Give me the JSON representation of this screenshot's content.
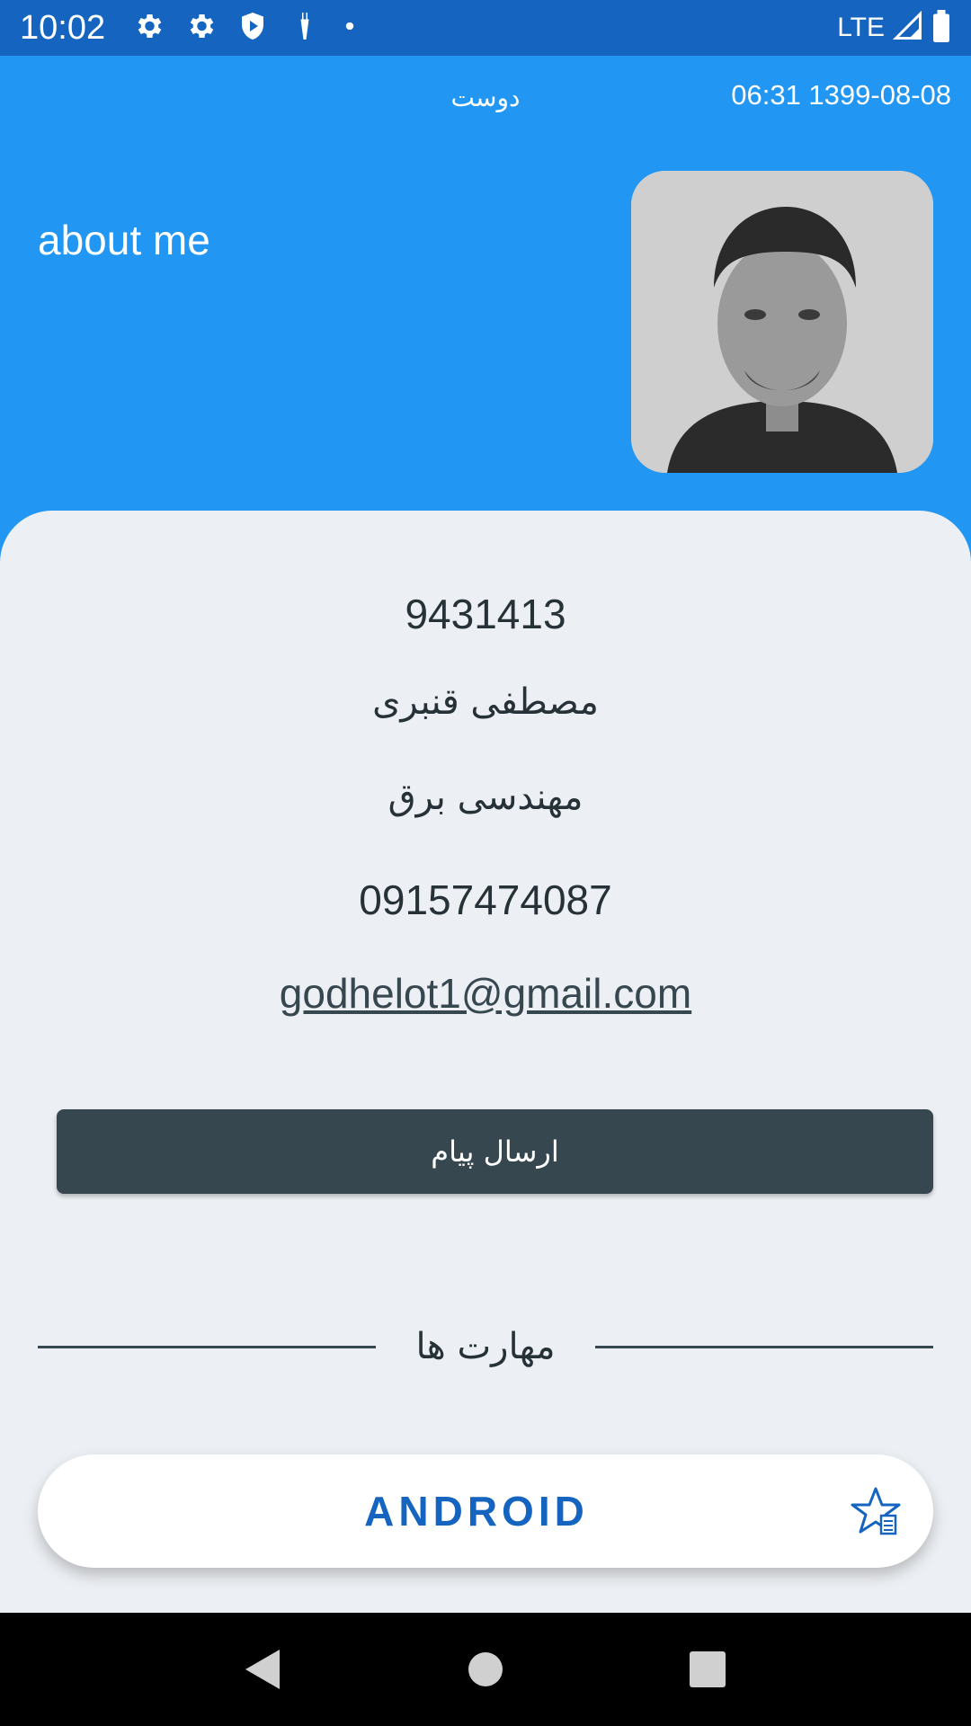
{
  "status_bar": {
    "time": "10:02",
    "icons": [
      "gear-icon",
      "gear-icon",
      "shield-play-icon",
      "carrot-icon",
      "dot-icon"
    ],
    "network": "LTE"
  },
  "header": {
    "subtitle": "دوست",
    "datetime": "06:31 1399-08-08",
    "about": "about me",
    "background_color": "#2196F3"
  },
  "profile": {
    "id": "9431413",
    "name": "مصطفی قنبری",
    "major": "مهندسی برق",
    "phone": "09157474087",
    "email": "godhelot1@gmail.com"
  },
  "actions": {
    "send_message": "ارسال پیام"
  },
  "skills": {
    "title": "مهارت ها",
    "items": [
      {
        "label": "ANDROID",
        "icon": "star-list-icon"
      }
    ]
  },
  "nav": {
    "buttons": [
      "back-icon",
      "home-icon",
      "recents-icon"
    ]
  },
  "colors": {
    "status_bar": "#1565C0",
    "accent": "#2196F3",
    "card_background": "#ECEFF3",
    "button": "#37474F",
    "skill_text": "#1565C0"
  }
}
